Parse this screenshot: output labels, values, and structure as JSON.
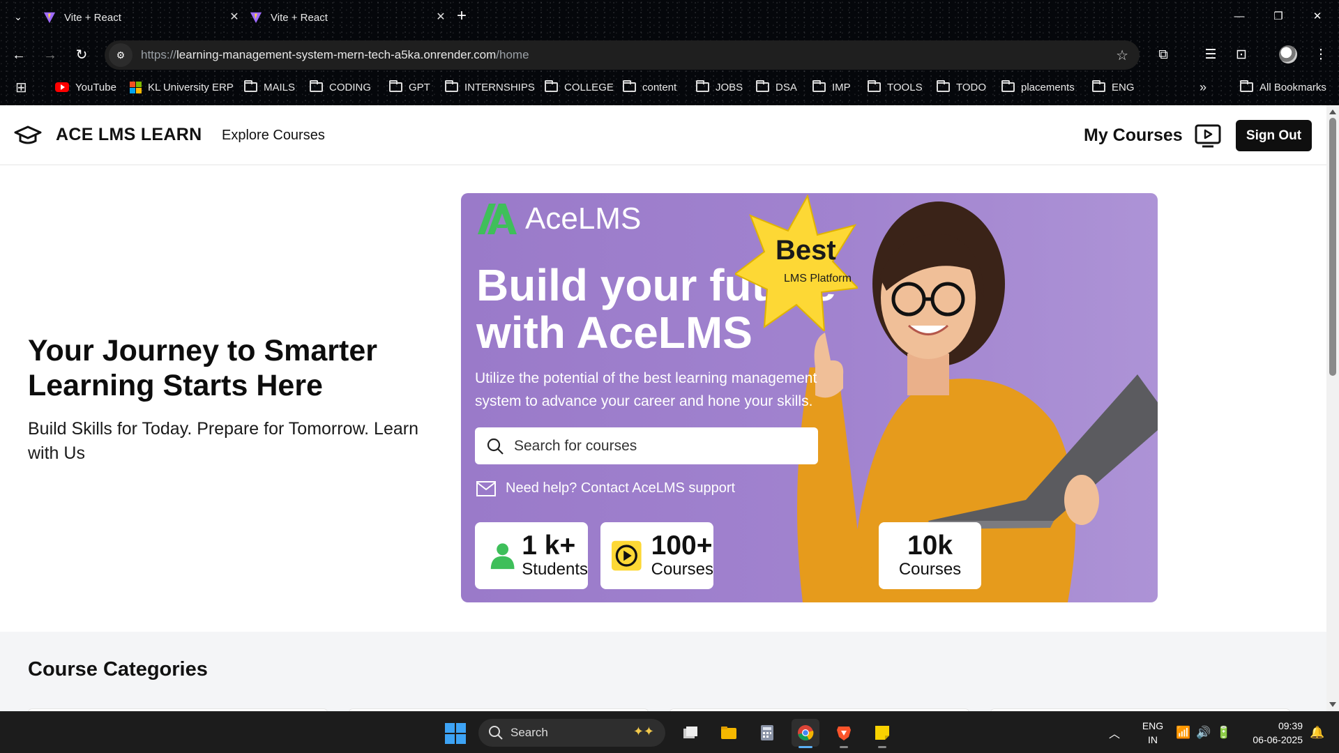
{
  "browser": {
    "tabs": [
      {
        "title": "Vite + React"
      },
      {
        "title": "Vite + React"
      }
    ],
    "url": {
      "scheme": "https://",
      "host": "learning-management-system-mern-tech-a5ka.onrender.com",
      "path": "/home"
    },
    "bookmarks": [
      {
        "label": "YouTube",
        "icon": "youtube-icon"
      },
      {
        "label": "KL University ERP",
        "icon": "kl-icon"
      },
      {
        "label": "MAILS",
        "icon": "folder-icon"
      },
      {
        "label": "CODING",
        "icon": "folder-icon"
      },
      {
        "label": "GPT",
        "icon": "folder-icon"
      },
      {
        "label": "INTERNSHIPS",
        "icon": "folder-icon"
      },
      {
        "label": "COLLEGE",
        "icon": "folder-icon"
      },
      {
        "label": "content",
        "icon": "folder-icon"
      },
      {
        "label": "JOBS",
        "icon": "folder-icon"
      },
      {
        "label": "DSA",
        "icon": "folder-icon"
      },
      {
        "label": "IMP",
        "icon": "folder-icon"
      },
      {
        "label": "TOOLS",
        "icon": "folder-icon"
      },
      {
        "label": "TODO",
        "icon": "folder-icon"
      },
      {
        "label": "placements",
        "icon": "folder-icon"
      },
      {
        "label": "ENG",
        "icon": "folder-icon"
      }
    ],
    "more_bookmarks": "»",
    "all_bookmarks": "All Bookmarks"
  },
  "header": {
    "brand": "ACE LMS LEARN",
    "explore": "Explore Courses",
    "my_courses": "My Courses",
    "sign_out": "Sign Out"
  },
  "hero": {
    "title": "Your Journey to Smarter Learning Starts Here",
    "subtitle": "Build Skills for Today. Prepare for Tomorrow. Learn with Us"
  },
  "banner": {
    "logo": "AceLMS",
    "badge_title": "Best",
    "badge_sub": "LMS Platform",
    "headline": "Build your future with AceLMS",
    "description": "Utilize the potential of the best learning management system to advance your career and hone your skills.",
    "search_placeholder": "Search for courses",
    "help": "Need help? Contact AceLMS support",
    "stats": [
      {
        "number": "1 k+",
        "label": "Students"
      },
      {
        "number": "100+",
        "label": "Courses"
      },
      {
        "number": "10k",
        "label": "Courses"
      }
    ]
  },
  "categories": {
    "title": "Course Categories"
  },
  "taskbar": {
    "search": "Search",
    "lang_top": "ENG",
    "lang_bottom": "IN",
    "time": "09:39",
    "date": "06-06-2025"
  },
  "colors": {
    "brand_dark": "#0f0f0f",
    "banner_purple": "#a183cf",
    "badge_yellow": "#fdd835",
    "logo_green": "#4caf50",
    "sweater_orange": "#e8a020"
  }
}
